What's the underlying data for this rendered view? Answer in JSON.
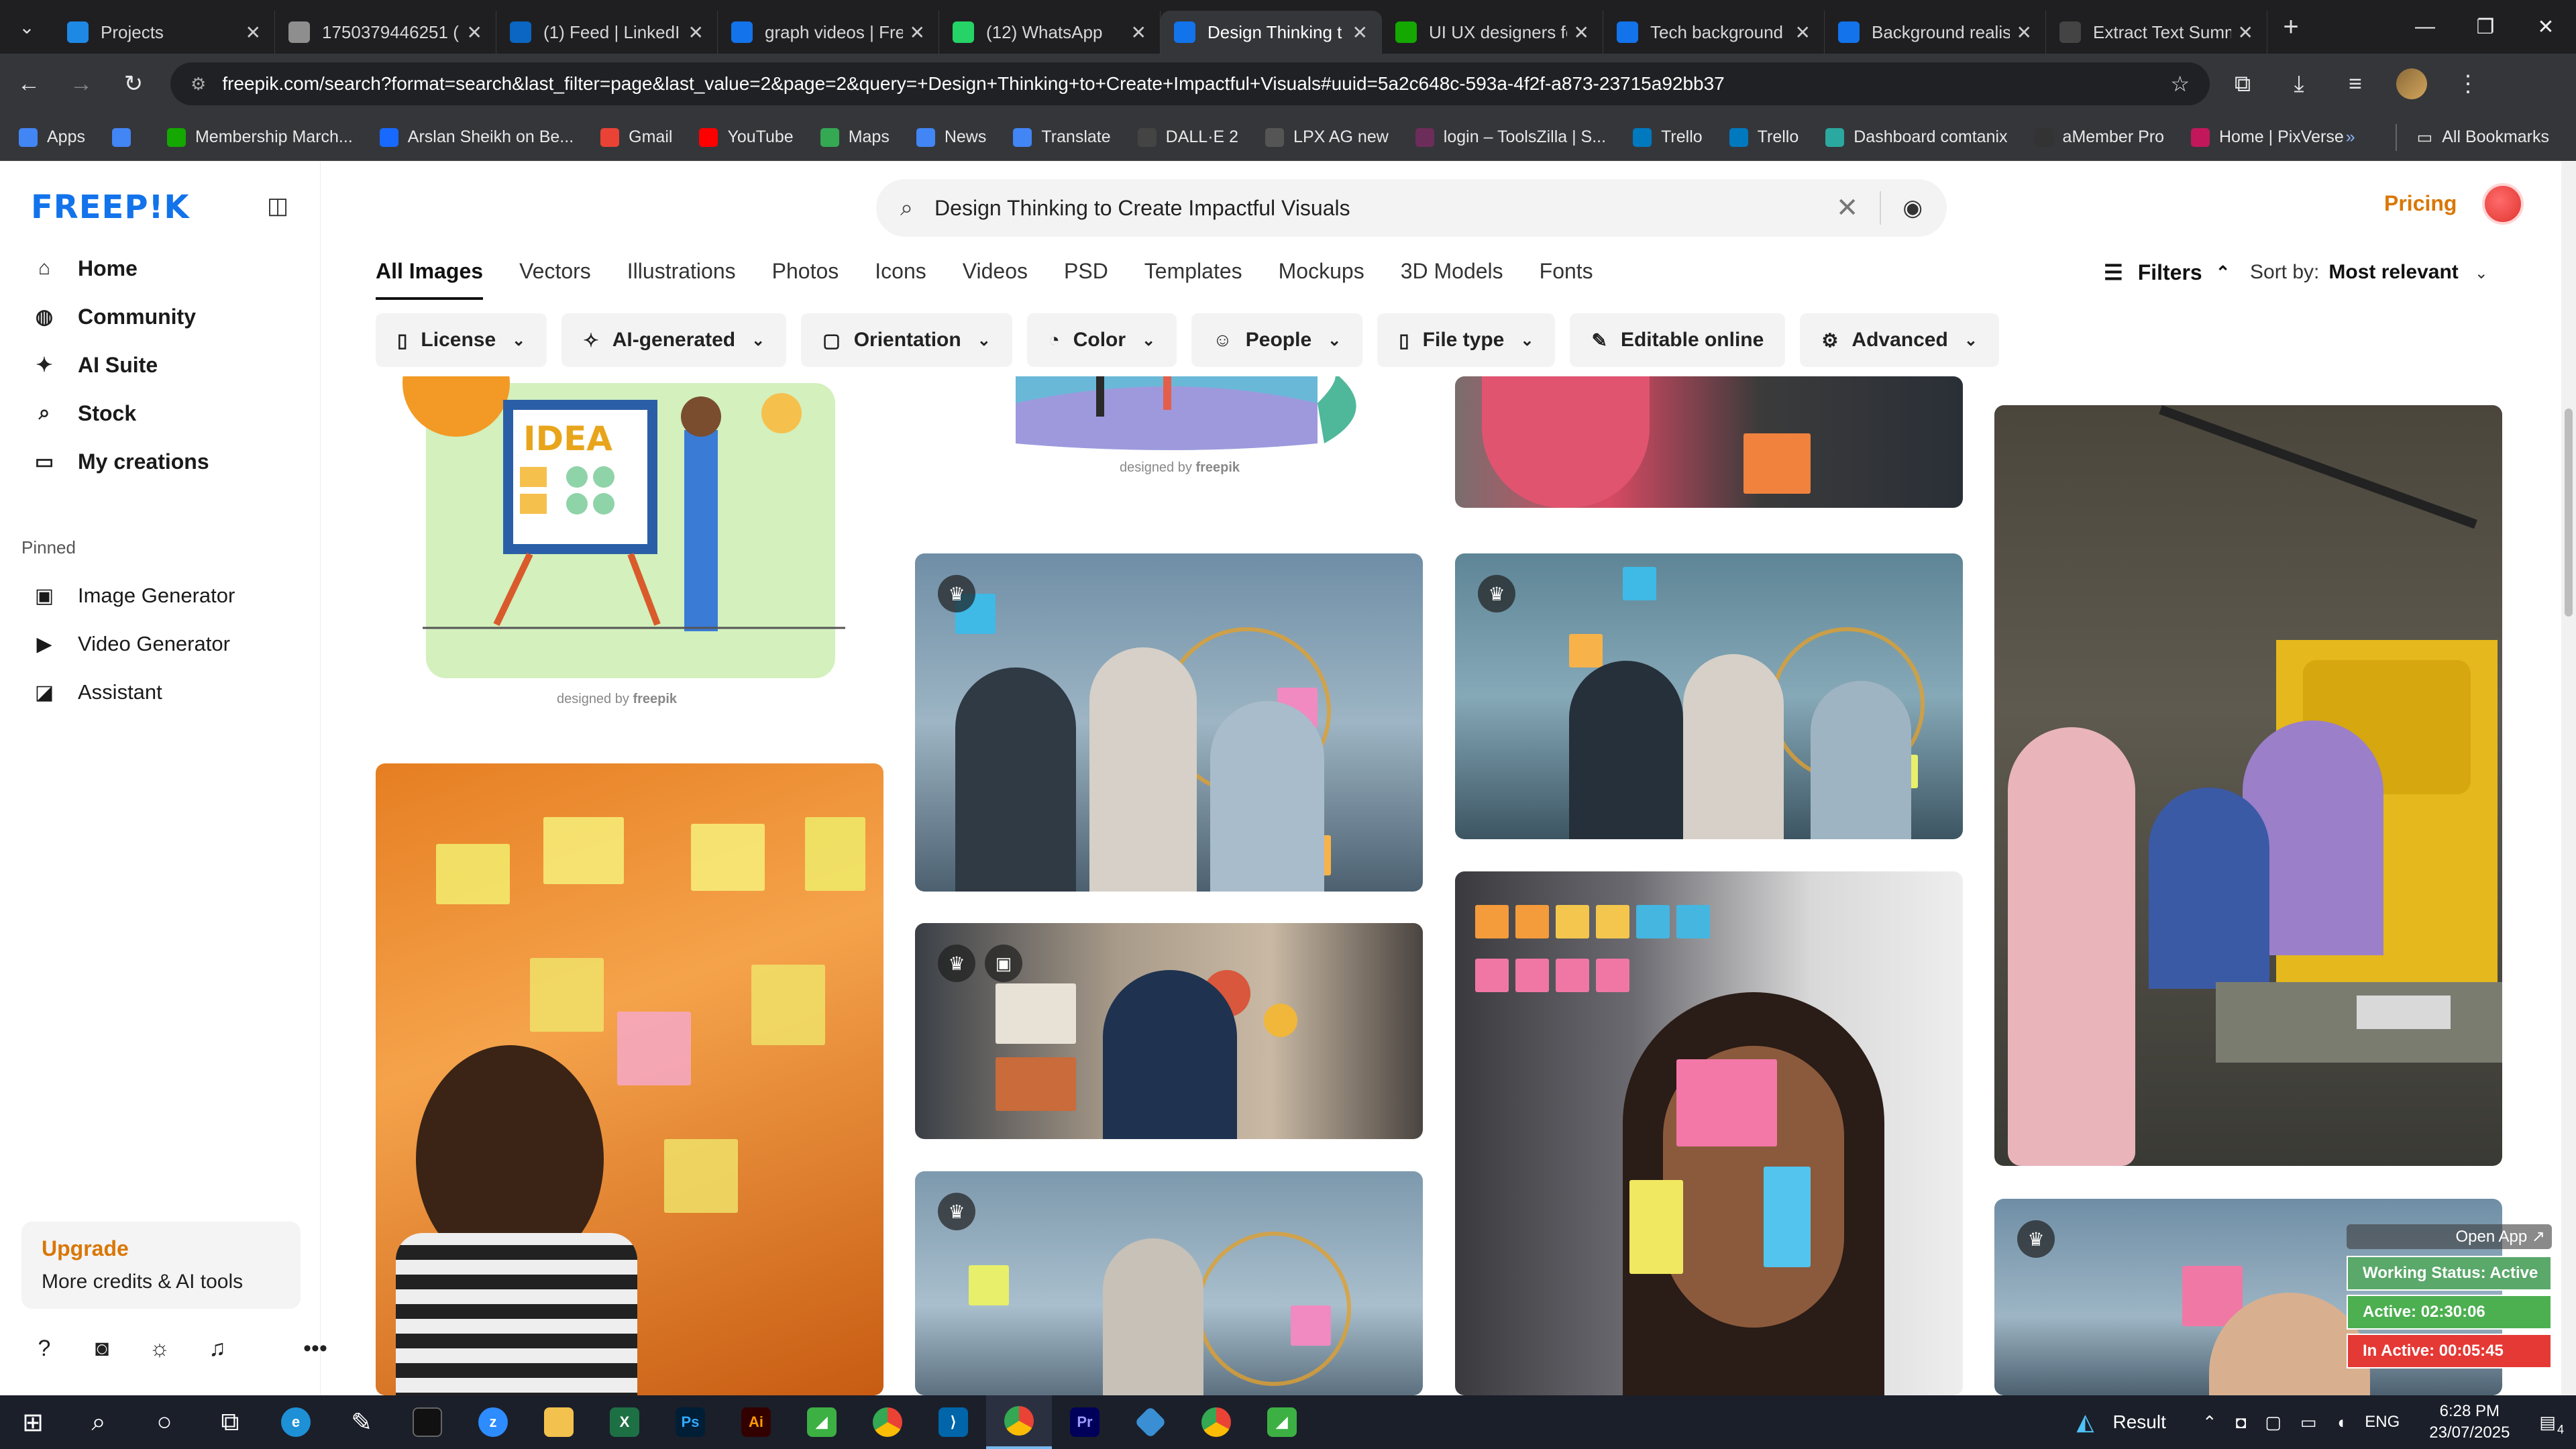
{
  "browser": {
    "tabs": [
      {
        "title": "Projects",
        "color": "#1e88e5"
      },
      {
        "title": "1750379446251 (",
        "color": "#8e8e8e"
      },
      {
        "title": "(1) Feed | LinkedI",
        "color": "#0a66c2"
      },
      {
        "title": "graph videos | Fre",
        "color": "#1273eb"
      },
      {
        "title": "(12) WhatsApp",
        "color": "#25d366"
      },
      {
        "title": "Design Thinking t",
        "color": "#1273eb"
      },
      {
        "title": "UI UX designers fo",
        "color": "#14a800"
      },
      {
        "title": "Tech background",
        "color": "#1273eb"
      },
      {
        "title": "Background realis",
        "color": "#1273eb"
      },
      {
        "title": "Extract Text Summ",
        "color": "#444444"
      }
    ],
    "active_tab_index": 5,
    "url": "freepik.com/search?format=search&last_filter=page&last_value=2&page=2&query=+Design+Thinking+to+Create+Impactful+Visuals#uuid=5a2c648c-593a-4f2f-a873-23715a92bb37",
    "bookmarks": [
      {
        "label": "Apps",
        "color": "#4285f4"
      },
      {
        "label": "",
        "color": "#4285f4"
      },
      {
        "label": "Membership March...",
        "color": "#14a800"
      },
      {
        "label": "Arslan Sheikh on Be...",
        "color": "#1769ff"
      },
      {
        "label": "Gmail",
        "color": "#ea4335"
      },
      {
        "label": "YouTube",
        "color": "#ff0000"
      },
      {
        "label": "Maps",
        "color": "#34a853"
      },
      {
        "label": "News",
        "color": "#4285f4"
      },
      {
        "label": "Translate",
        "color": "#4285f4"
      },
      {
        "label": "DALL·E 2",
        "color": "#444444"
      },
      {
        "label": "LPX AG new",
        "color": "#555555"
      },
      {
        "label": "login – ToolsZilla | S...",
        "color": "#6d2d5a"
      },
      {
        "label": "Trello",
        "color": "#0079bf"
      },
      {
        "label": "Trello",
        "color": "#0079bf"
      },
      {
        "label": "Dashboard comtanix",
        "color": "#2ba8a0"
      },
      {
        "label": "aMember Pro",
        "color": "#333333"
      },
      {
        "label": "Home | PixVerse",
        "color": "#c2185b"
      }
    ],
    "all_bookmarks": "All Bookmarks"
  },
  "sidebar": {
    "logo": "FREEP!K",
    "nav": [
      "Home",
      "Community",
      "AI Suite",
      "Stock",
      "My creations"
    ],
    "pinned_heading": "Pinned",
    "pinned": [
      "Image Generator",
      "Video Generator",
      "Assistant"
    ],
    "upgrade_title": "Upgrade",
    "upgrade_sub": "More credits & AI tools"
  },
  "header": {
    "search_query": "Design Thinking to Create Impactful Visuals",
    "pricing": "Pricing"
  },
  "type_tabs": [
    "All Images",
    "Vectors",
    "Illustrations",
    "Photos",
    "Icons",
    "Videos",
    "PSD",
    "Templates",
    "Mockups",
    "3D Models",
    "Fonts"
  ],
  "active_type_tab": "All Images",
  "filters_label": "Filters",
  "sort": {
    "label": "Sort by:",
    "value": "Most relevant"
  },
  "filter_chips": [
    "License",
    "AI-generated",
    "Orientation",
    "Color",
    "People",
    "File type",
    "Editable online",
    "Advanced"
  ],
  "grid": {
    "designed_by": "designed by",
    "freepik": "freepik",
    "idea_text": "IDEA"
  },
  "widget": {
    "open_app": "Open App ↗",
    "working_status": "Working Status: Active",
    "active": "Active: 02:30:06",
    "inactive": "In Active: 00:05:45",
    "colors": {
      "status": "#5aa86a",
      "active": "#4caf50",
      "inactive": "#e53935"
    }
  },
  "taskbar": {
    "result_label": "Result",
    "lang": "ENG",
    "time": "6:28 PM",
    "date": "23/07/2025",
    "notifications": "4"
  }
}
